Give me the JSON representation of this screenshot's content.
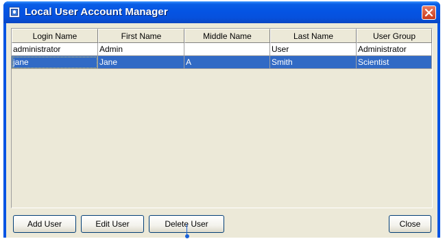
{
  "window": {
    "title": "Local User Account Manager",
    "colors": {
      "titlebar": "#0554e3",
      "selection": "#316ac5",
      "face": "#ece9d8"
    }
  },
  "table": {
    "columns": [
      "Login Name",
      "First Name",
      "Middle Name",
      "Last Name",
      "User Group"
    ],
    "rows": [
      [
        "administrator",
        "Admin",
        "",
        "User",
        "Administrator"
      ],
      [
        "jane",
        "Jane",
        "A",
        "Smith",
        "Scientist"
      ]
    ],
    "selected_row": 1
  },
  "buttons": {
    "add": "Add User",
    "edit": "Edit User",
    "delete": "Delete User",
    "close": "Close"
  }
}
